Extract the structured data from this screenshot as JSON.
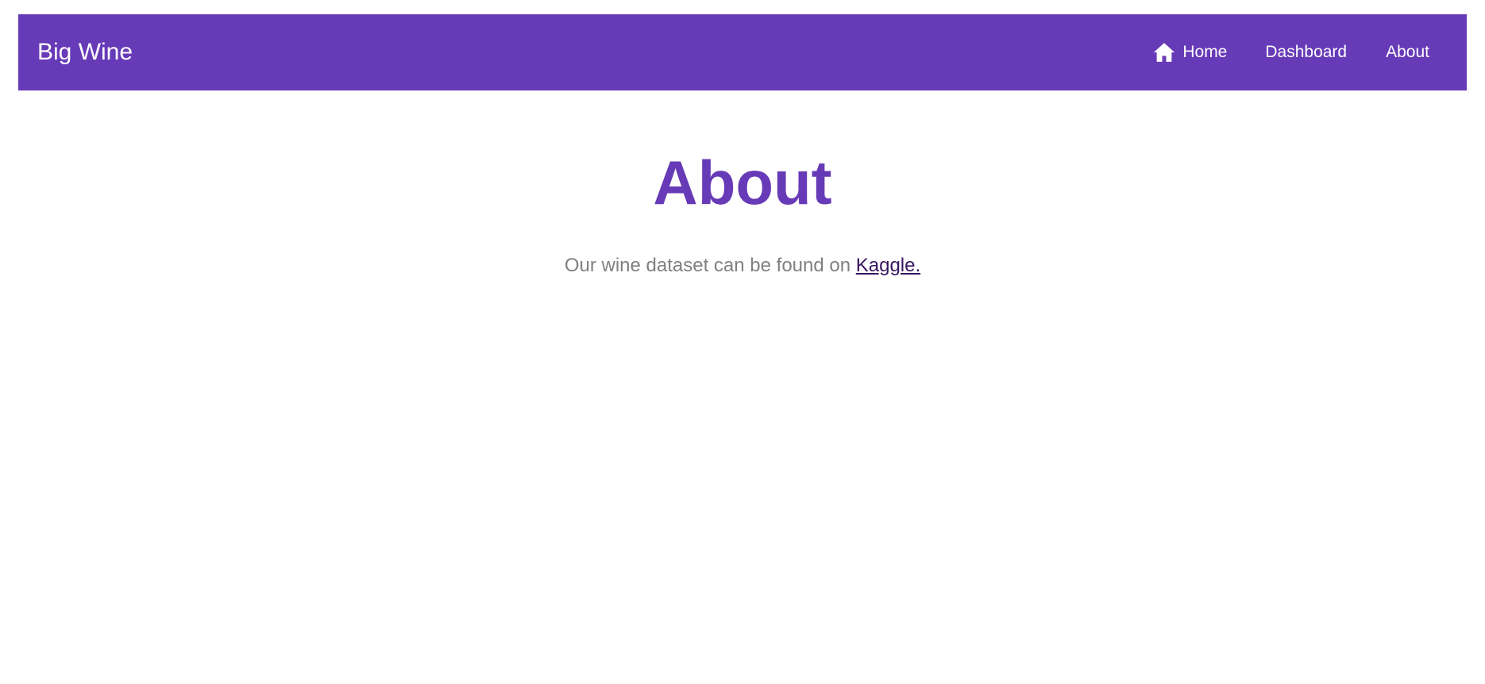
{
  "navbar": {
    "brand": "Big Wine",
    "links": [
      {
        "label": "Home",
        "icon": "home-icon"
      },
      {
        "label": "Dashboard"
      },
      {
        "label": "About"
      }
    ],
    "background_color": "#673ab7"
  },
  "main": {
    "title": "About",
    "text": "Our wine dataset can be found on ",
    "link_label": "Kaggle."
  },
  "colors": {
    "accent": "#673ab7",
    "link": "#3a1560",
    "body_text": "#808080"
  }
}
